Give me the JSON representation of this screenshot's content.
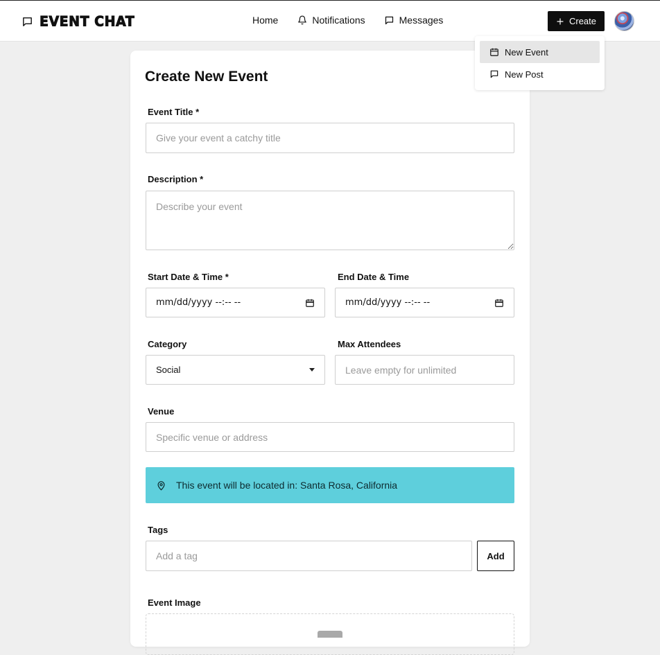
{
  "header": {
    "brand": "EVENT CHAT",
    "nav": [
      {
        "label": "Home",
        "icon": "none"
      },
      {
        "label": "Notifications",
        "icon": "bell-icon"
      },
      {
        "label": "Messages",
        "icon": "message-icon"
      }
    ],
    "create_label": "Create"
  },
  "create_menu": {
    "items": [
      {
        "label": "New Event",
        "icon": "calendar-icon"
      },
      {
        "label": "New Post",
        "icon": "message-icon"
      }
    ]
  },
  "form": {
    "title": "Create New Event",
    "event_title": {
      "label": "Event Title *",
      "placeholder": "Give your event a catchy title"
    },
    "description": {
      "label": "Description *",
      "placeholder": "Describe your event"
    },
    "start": {
      "label": "Start Date & Time *",
      "value": "mm/dd/yyyy --:-- --"
    },
    "end": {
      "label": "End Date & Time",
      "value": "mm/dd/yyyy --:-- --"
    },
    "category": {
      "label": "Category",
      "value": "Social"
    },
    "max_attendees": {
      "label": "Max Attendees",
      "placeholder": "Leave empty for unlimited"
    },
    "venue": {
      "label": "Venue",
      "placeholder": "Specific venue or address"
    },
    "location_notice": "This event will be located in: Santa Rosa, California",
    "tags": {
      "label": "Tags",
      "placeholder": "Add a tag",
      "add_label": "Add"
    },
    "image": {
      "label": "Event Image"
    }
  },
  "colors": {
    "accent_dark": "#0f0f0f",
    "location_banner": "#5ecfdc",
    "page_bg": "#efefef"
  }
}
